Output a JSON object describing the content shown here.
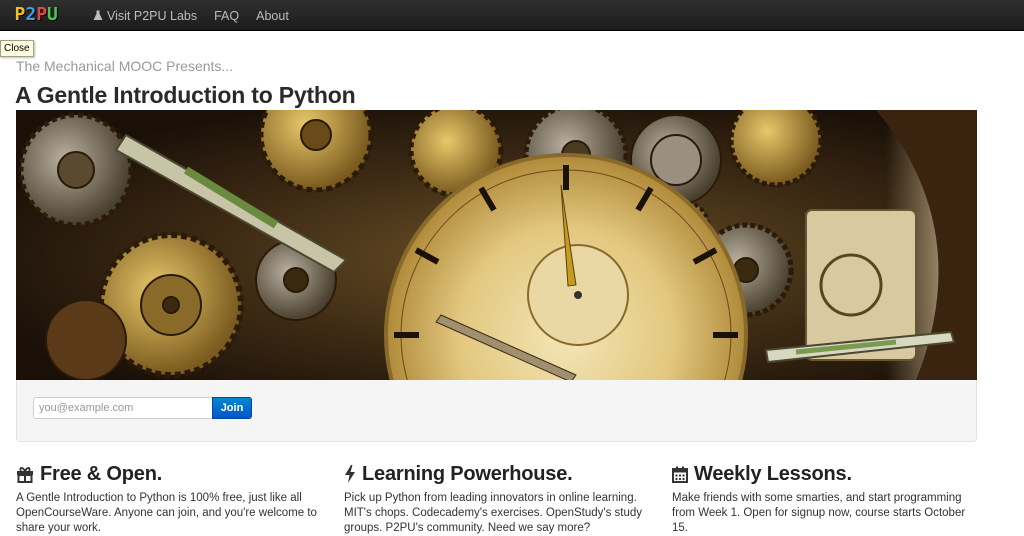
{
  "navbar": {
    "logo_letters": [
      {
        "char": "P",
        "color": "#f0c020"
      },
      {
        "char": "2",
        "color": "#3aa0e0"
      },
      {
        "char": "P",
        "color": "#e04848"
      },
      {
        "char": "U",
        "color": "#50c050"
      }
    ],
    "links": [
      {
        "label": "Visit P2PU Labs",
        "icon": "flask-icon"
      },
      {
        "label": "FAQ"
      },
      {
        "label": "About"
      }
    ]
  },
  "tooltip": {
    "text": "Close"
  },
  "header": {
    "presents": "The Mechanical MOOC Presents...",
    "title": "A Gentle Introduction to Python"
  },
  "signup": {
    "email_placeholder": "you@example.com",
    "join_label": "Join",
    "accent_color": "#0088cc"
  },
  "features": [
    {
      "icon": "gift-icon",
      "title": "Free & Open.",
      "text": "A Gentle Introduction to Python is 100% free, just like all OpenCourseWare. Anyone can join, and you're welcome to share your work."
    },
    {
      "icon": "bolt-icon",
      "title": "Learning Powerhouse.",
      "text": "Pick up Python from leading innovators in online learning. MIT's chops. Codecademy's exercises. OpenStudy's study groups. P2PU's community. Need we say more?"
    },
    {
      "icon": "calendar-icon",
      "title": "Weekly Lessons.",
      "text": "Make friends with some smarties, and start programming from Week 1. Open for signup now, course starts October 15."
    }
  ]
}
